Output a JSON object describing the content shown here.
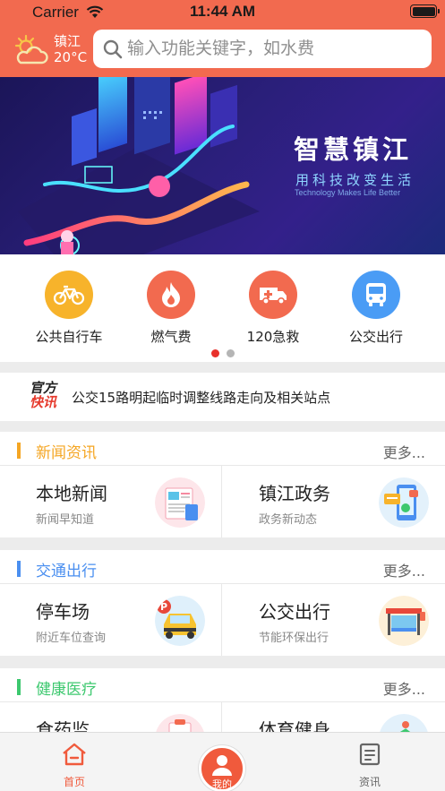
{
  "status_bar": {
    "carrier": "Carrier",
    "time": "11:44 AM"
  },
  "header": {
    "city": "镇江",
    "temperature": "20°C",
    "weather_icon": "partly-cloudy-icon",
    "search_placeholder": "输入功能关键字，如水费"
  },
  "banner": {
    "title": "智慧镇江",
    "subtitle": "用科技改变生活",
    "english": "Technology Makes Life Better"
  },
  "services": [
    {
      "label": "公共自行车",
      "icon": "bicycle-icon",
      "color": "#f7b32b"
    },
    {
      "label": "燃气费",
      "icon": "flame-icon",
      "color": "#f26a4f"
    },
    {
      "label": "120急救",
      "icon": "ambulance-icon",
      "color": "#f26a4f"
    },
    {
      "label": "公交出行",
      "icon": "bus-icon",
      "color": "#4a9cf5"
    }
  ],
  "pager": {
    "pages": 2,
    "active": 1
  },
  "notice": {
    "logo_line1": "官方",
    "logo_line2": "快讯",
    "text": "公交15路明起临时调整线路走向及相关站点"
  },
  "sections": [
    {
      "name": "新闻资讯",
      "more": "更多...",
      "color": "#f5a623",
      "cards": [
        {
          "title": "本地新闻",
          "sub": "新闻早知道",
          "icon": "news-icon"
        },
        {
          "title": "镇江政务",
          "sub": "政务新动态",
          "icon": "phone-services-icon"
        }
      ]
    },
    {
      "name": "交通出行",
      "more": "更多...",
      "color": "#4a8ff0",
      "cards": [
        {
          "title": "停车场",
          "sub": "附近车位查询",
          "icon": "parking-car-icon"
        },
        {
          "title": "公交出行",
          "sub": "节能环保出行",
          "icon": "bus-stop-icon"
        }
      ]
    },
    {
      "name": "健康医疗",
      "more": "更多...",
      "color": "#3cc86e",
      "cards": [
        {
          "title": "食药监",
          "sub": "",
          "icon": "food-drug-icon"
        },
        {
          "title": "体育健身",
          "sub": "",
          "icon": "fitness-icon"
        }
      ]
    }
  ],
  "tabbar": {
    "tabs": [
      {
        "label": "首页",
        "icon": "home-icon"
      },
      {
        "label": "我的",
        "icon": "user-icon"
      },
      {
        "label": "资讯",
        "icon": "document-icon"
      }
    ],
    "active": "首页",
    "accent": "#f05a3c"
  }
}
